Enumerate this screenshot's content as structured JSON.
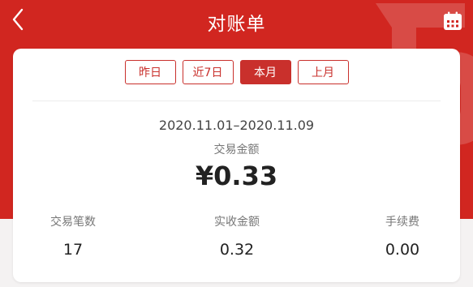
{
  "header": {
    "title": "对账单",
    "back_icon": "chevron-left-icon",
    "calendar_icon": "calendar-icon"
  },
  "tabs": [
    {
      "label": "昨日",
      "active": false
    },
    {
      "label": "近7日",
      "active": false
    },
    {
      "label": "本月",
      "active": true
    },
    {
      "label": "上月",
      "active": false
    }
  ],
  "summary": {
    "date_range": "2020.11.01–2020.11.09",
    "amount_label": "交易金额",
    "amount_value": "¥0.33"
  },
  "stats": [
    {
      "label": "交易笔数",
      "value": "17"
    },
    {
      "label": "实收金额",
      "value": "0.32"
    },
    {
      "label": "手续费",
      "value": "0.00"
    }
  ],
  "colors": {
    "brand_red": "#d12620",
    "tab_red": "#c9302c",
    "background": "#f4f2f2"
  }
}
